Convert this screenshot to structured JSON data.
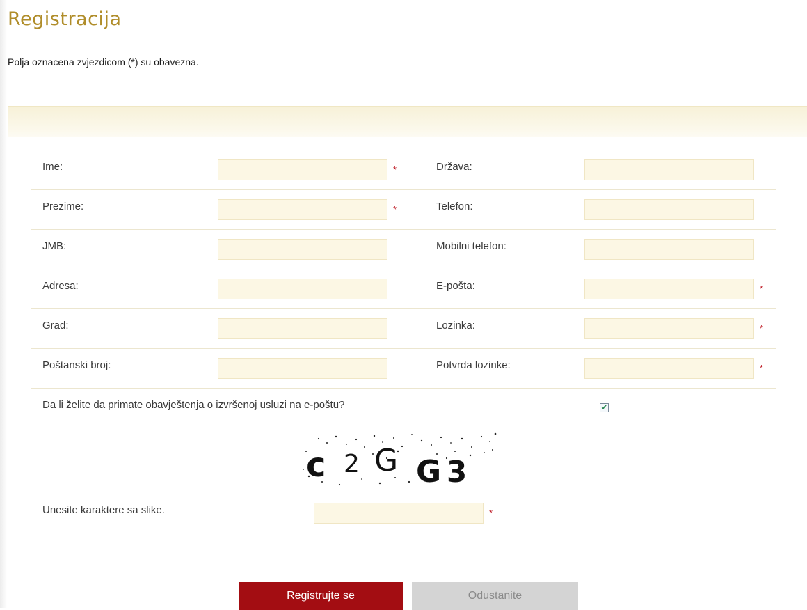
{
  "page": {
    "title": "Registracija",
    "required_note": "Polja oznacena zvjezdicom (*) su obavezna."
  },
  "form": {
    "left_fields": [
      {
        "label": "Ime:",
        "value": "",
        "required": true
      },
      {
        "label": "Prezime:",
        "value": "",
        "required": true
      },
      {
        "label": "JMB:",
        "value": "",
        "required": false
      },
      {
        "label": "Adresa:",
        "value": "",
        "required": false
      },
      {
        "label": "Grad:",
        "value": "",
        "required": false
      },
      {
        "label": "Poštanski broj:",
        "value": "",
        "required": false
      }
    ],
    "right_fields": [
      {
        "label": "Država:",
        "value": "",
        "required": false
      },
      {
        "label": "Telefon:",
        "value": "",
        "required": false
      },
      {
        "label": "Mobilni telefon:",
        "value": "",
        "required": false
      },
      {
        "label": "E-pošta:",
        "value": "",
        "required": true
      },
      {
        "label": "Lozinka:",
        "value": "",
        "required": true
      },
      {
        "label": "Potvrda lozinke:",
        "value": "",
        "required": true
      }
    ],
    "required_marker": "*",
    "notify": {
      "label": "Da li želite da primate obavještenja o izvršenoj usluzi na e-poštu?",
      "checked": true,
      "check_glyph": "✔"
    },
    "captcha": {
      "text": "c2GG3",
      "input_label": "Unesite karaktere sa slike.",
      "value": ""
    }
  },
  "buttons": {
    "register_label": "Registrujte se",
    "cancel_label": "Odustanite"
  },
  "colors": {
    "title": "#b08d2a",
    "required": "#c0212b",
    "input_bg": "#fcf7e4",
    "primary_button": "#a30d12",
    "secondary_button": "#d4d4d4"
  }
}
